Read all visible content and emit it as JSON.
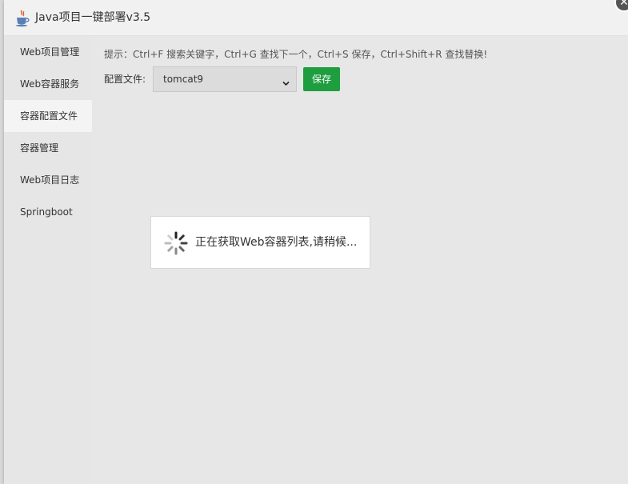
{
  "window": {
    "title": "Java项目一键部署v3.5",
    "close_label": "✕"
  },
  "sidebar": {
    "items": [
      {
        "label": "Web项目管理",
        "active": false
      },
      {
        "label": "Web容器服务",
        "active": false
      },
      {
        "label": "容器配置文件",
        "active": true
      },
      {
        "label": "容器管理",
        "active": false
      },
      {
        "label": "Web项目日志",
        "active": false
      },
      {
        "label": "Springboot",
        "active": false
      }
    ]
  },
  "main": {
    "hint": "提示：Ctrl+F 搜索关键字，Ctrl+G 查找下一个，Ctrl+S 保存，Ctrl+Shift+R 查找替换!",
    "config_label": "配置文件:",
    "config_selected": "tomcat9",
    "save_label": "保存"
  },
  "loading": {
    "text": "正在获取Web容器列表,请稍候..."
  },
  "colors": {
    "accent": "#1e9e3e",
    "active_item_bg": "#f4f4f4",
    "panel_bg": "#e7e7e7"
  }
}
